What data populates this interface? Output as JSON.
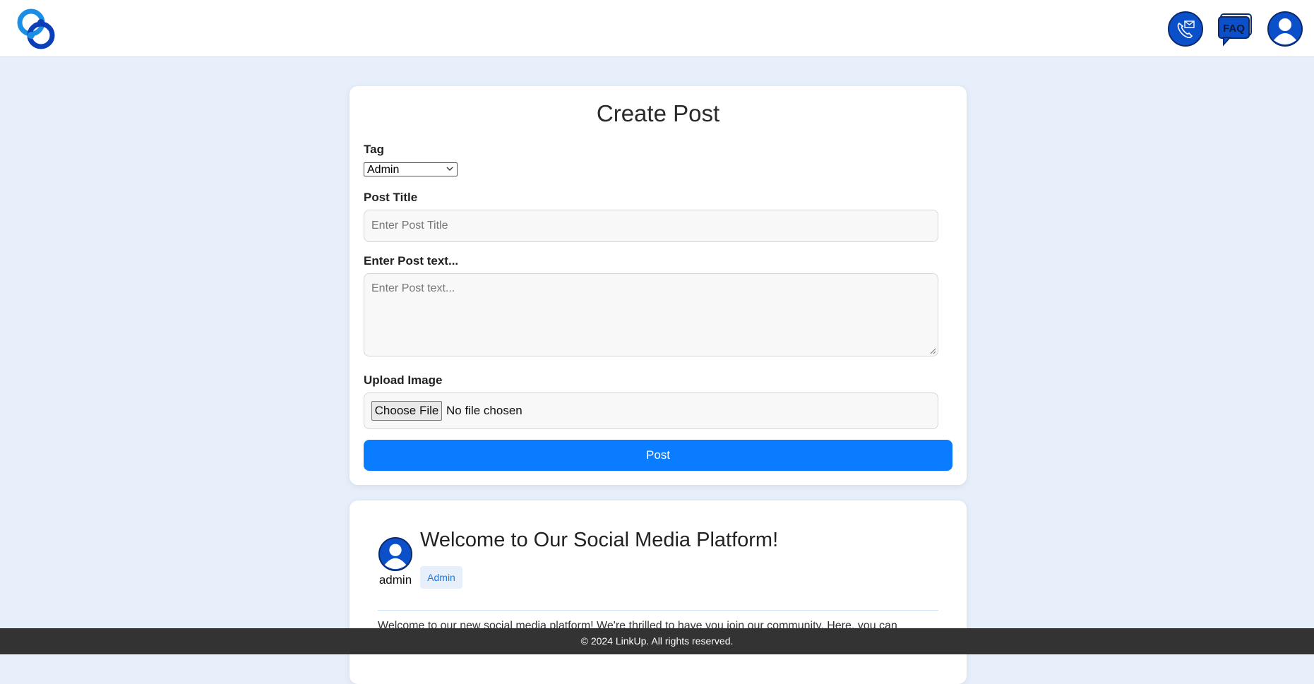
{
  "header": {
    "logo_icon": "linkup-logo-icon",
    "contact_icon": "phone-mail-icon",
    "faq_icon_text": "FAQ",
    "profile_icon": "user-avatar-icon"
  },
  "create_post": {
    "title": "Create Post",
    "tag_label": "Tag",
    "tag_selected": "Admin",
    "post_title_label": "Post Title",
    "post_title_placeholder": "Enter Post Title",
    "post_text_label": "Enter Post text...",
    "post_text_placeholder": "Enter Post text...",
    "upload_label": "Upload Image",
    "choose_file_label": "Choose File",
    "file_status": "No file chosen",
    "submit_label": "Post"
  },
  "post": {
    "author": "admin",
    "title": "Welcome to Our Social Media Platform!",
    "tag": "Admin",
    "body": "Welcome to our new social media platform! We're thrilled to have you join our community. Here, you can"
  },
  "footer": {
    "text": "© 2024 LinkUp. All rights reserved."
  },
  "colors": {
    "page_bg": "#e7effb",
    "primary": "#0a7cff",
    "brand_blue": "#0b4fc9",
    "footer_bg": "#333333"
  }
}
